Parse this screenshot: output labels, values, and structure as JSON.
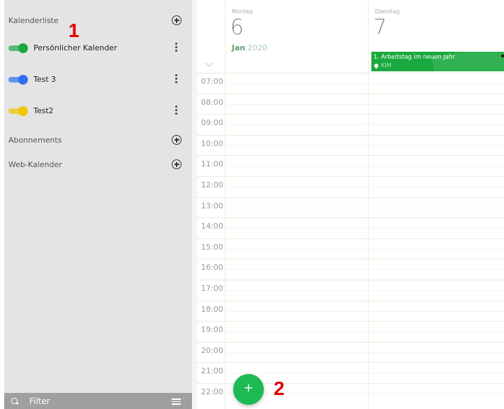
{
  "sidebar": {
    "calendar_list_title": "Kalenderliste",
    "calendars": [
      {
        "label": "Persönlicher Kalender",
        "color": "#1aa93e",
        "enabled": true
      },
      {
        "label": "Test 3",
        "color": "#2f6ff2",
        "enabled": true
      },
      {
        "label": "Test2",
        "color": "#f5c400",
        "enabled": true
      }
    ],
    "subscriptions_title": "Abonnements",
    "web_calendar_title": "Web-Kalender",
    "filter_placeholder": "Filter"
  },
  "calendar": {
    "days": [
      {
        "weekday": "Montag",
        "day": "6"
      },
      {
        "weekday": "Dienstag",
        "day": "7"
      }
    ],
    "month": "Jan",
    "year": "2020",
    "times": [
      "07:00",
      "08:00",
      "09:00",
      "10:00",
      "11:00",
      "12:00",
      "13:00",
      "14:00",
      "15:00",
      "16:00",
      "17:00",
      "18:00",
      "19:00",
      "20:00",
      "21:00",
      "22:00"
    ],
    "event": {
      "title": "1. Arbeitstag im neuen Jahr",
      "location": "KIM",
      "color": "#1aa93e"
    },
    "fab_label": "+"
  },
  "annotations": [
    "1",
    "2"
  ]
}
